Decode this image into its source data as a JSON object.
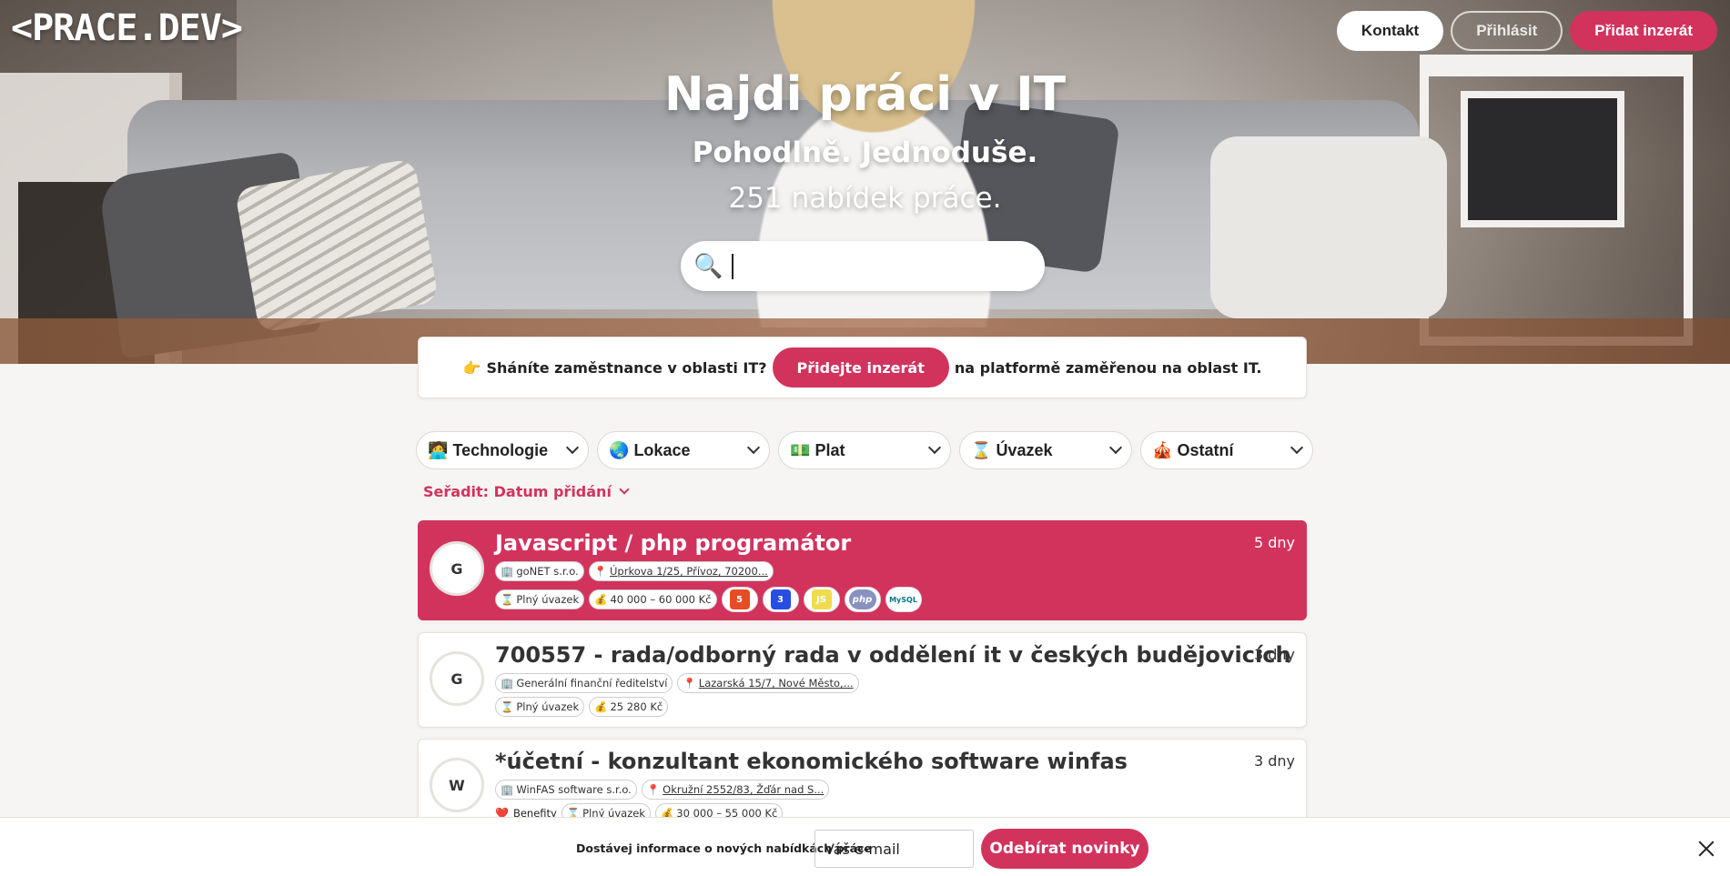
{
  "brand": {
    "logo": "<PRACE.DEV>"
  },
  "topnav": {
    "contact": "Kontakt",
    "login": "Přihlásit",
    "add": "Přidat inzerát"
  },
  "hero": {
    "title": "Najdi práci v IT",
    "subtitle": "Pohodlně. Jednoduše.",
    "count_text": "251 nabídek práce.",
    "search_icon": "🔍",
    "search_value": ""
  },
  "promo": {
    "emoji": "👉",
    "lead": "Sháníte zaměstnance v oblasti IT?",
    "button": "Přidejte inzerát",
    "tail": "na platformě zaměřenou na oblast IT."
  },
  "filters": [
    {
      "icon": "🧑‍💻",
      "label": "Technologie"
    },
    {
      "icon": "🌏",
      "label": "Lokace"
    },
    {
      "icon": "💵",
      "label": "Plat"
    },
    {
      "icon": "⌛",
      "label": "Úvazek"
    },
    {
      "icon": "🎪",
      "label": "Ostatní"
    }
  ],
  "sort": {
    "label": "Seřadit: Datum přidání"
  },
  "jobs": [
    {
      "initial": "G",
      "title": "Javascript / php programátor",
      "age": "5 dny",
      "company": "goNET s.r.o.",
      "location": "Úprkova 1/25, Přívoz, 70200...",
      "contract": "Plný úvazek",
      "salary": "40 000 – 60 000 Kč",
      "company_icon": "🏢",
      "location_icon": "📍",
      "contract_icon": "⌛",
      "salary_icon": "💰",
      "techs": [
        {
          "name": "html5-icon",
          "glyph": "5",
          "color": "#e44d26"
        },
        {
          "name": "css3-icon",
          "glyph": "3",
          "color": "#264de4"
        },
        {
          "name": "js-icon",
          "glyph": "JS",
          "color": "#f0db4f"
        },
        {
          "name": "php-icon",
          "glyph": "php",
          "color": "#8892bf"
        },
        {
          "name": "mysql-icon",
          "glyph": "MySQL",
          "color": "#00758f"
        }
      ]
    },
    {
      "initial": "G",
      "title": "700557 - rada/odborný rada v oddělení it v českých budějovicích",
      "age": "3 dny",
      "company": "Generální finanční ředitelství",
      "location": "Lazarská 15/7, Nové Město,...",
      "contract": "Plný úvazek",
      "salary": "25 280 Kč",
      "company_icon": "🏢",
      "location_icon": "📍",
      "contract_icon": "⌛",
      "salary_icon": "💰"
    },
    {
      "initial": "W",
      "title": "*účetní - konzultant ekonomického software winfas",
      "age": "3 dny",
      "company": "WinFAS software s.r.o.",
      "location": "Okružní 2552/83, Žďár nad S...",
      "benefits": "Benefity",
      "contract": "Plný úvazek",
      "salary": "30 000 – 55 000 Kč",
      "company_icon": "🏢",
      "location_icon": "📍",
      "benefits_icon": "❤️",
      "contract_icon": "⌛",
      "salary_icon": "💰"
    }
  ],
  "newsletter": {
    "label": "Dostávej informace o nových nabídkách práce",
    "email_placeholder": "Váš e-mail",
    "subscribe": "Odebírat novinky"
  },
  "colors": {
    "accent": "#d2335d",
    "background": "#f7f5f3"
  }
}
